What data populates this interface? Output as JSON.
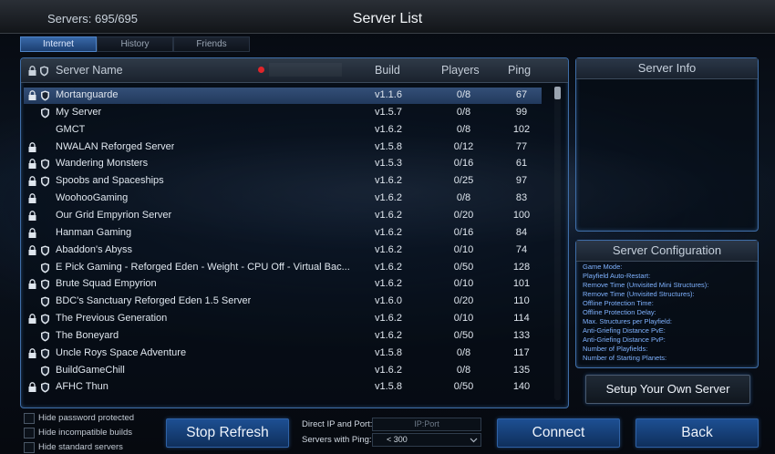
{
  "header": {
    "server_count": "Servers: 695/695",
    "title": "Server List"
  },
  "tabs": [
    {
      "label": "Internet",
      "active": true
    },
    {
      "label": "History"
    },
    {
      "label": "Friends"
    }
  ],
  "columns": {
    "name": "Server Name",
    "build": "Build",
    "players": "Players",
    "ping": "Ping"
  },
  "rows": [
    {
      "name": "Mortanguarde",
      "build": "v1.1.6",
      "players": "0/8",
      "ping": "67",
      "lock": true,
      "shield": true,
      "selected": true
    },
    {
      "name": "My Server",
      "build": "v1.5.7",
      "players": "0/8",
      "ping": "99",
      "lock": false,
      "shield": true
    },
    {
      "name": "GMCT",
      "build": "v1.6.2",
      "players": "0/8",
      "ping": "102",
      "lock": false,
      "shield": false
    },
    {
      "name": "NWALAN Reforged Server",
      "build": "v1.5.8",
      "players": "0/12",
      "ping": "77",
      "lock": true,
      "shield": false
    },
    {
      "name": "Wandering Monsters",
      "build": "v1.5.3",
      "players": "0/16",
      "ping": "61",
      "lock": true,
      "shield": true
    },
    {
      "name": "Spoobs and Spaceships",
      "build": "v1.6.2",
      "players": "0/25",
      "ping": "97",
      "lock": true,
      "shield": true
    },
    {
      "name": "WoohooGaming",
      "build": "v1.6.2",
      "players": "0/8",
      "ping": "83",
      "lock": true,
      "shield": false
    },
    {
      "name": "Our Grid Empyrion Server",
      "build": "v1.6.2",
      "players": "0/20",
      "ping": "100",
      "lock": true,
      "shield": false
    },
    {
      "name": "Hanman Gaming",
      "build": "v1.6.2",
      "players": "0/16",
      "ping": "84",
      "lock": true,
      "shield": false
    },
    {
      "name": "Abaddon's Abyss",
      "build": "v1.6.2",
      "players": "0/10",
      "ping": "74",
      "lock": true,
      "shield": true
    },
    {
      "name": "E Pick Gaming - Reforged Eden - Weight - CPU Off - Virtual Bac...",
      "build": "v1.6.2",
      "players": "0/50",
      "ping": "128",
      "lock": false,
      "shield": true
    },
    {
      "name": "Brute Squad Empyrion",
      "build": "v1.6.2",
      "players": "0/10",
      "ping": "101",
      "lock": true,
      "shield": true
    },
    {
      "name": "BDC's Sanctuary Reforged Eden 1.5 Server",
      "build": "v1.6.0",
      "players": "0/20",
      "ping": "110",
      "lock": false,
      "shield": true
    },
    {
      "name": "The Previous Generation",
      "build": "v1.6.2",
      "players": "0/10",
      "ping": "114",
      "lock": true,
      "shield": true
    },
    {
      "name": "The Boneyard",
      "build": "v1.6.2",
      "players": "0/50",
      "ping": "133",
      "lock": false,
      "shield": true
    },
    {
      "name": "Uncle Roys Space Adventure",
      "build": "v1.5.8",
      "players": "0/8",
      "ping": "117",
      "lock": true,
      "shield": true
    },
    {
      "name": "BuildGameChill",
      "build": "v1.6.2",
      "players": "0/8",
      "ping": "135",
      "lock": false,
      "shield": true
    },
    {
      "name": "AFHC Thun",
      "build": "v1.5.8",
      "players": "0/50",
      "ping": "140",
      "lock": true,
      "shield": true
    }
  ],
  "server_info": {
    "title": "Server Info"
  },
  "server_config": {
    "title": "Server Configuration",
    "items": [
      "Game Mode:",
      "Playfield Auto-Restart:",
      "Remove Time (Unvisited Mini Structures):",
      "Remove Time (Unvisited Structures):",
      "Offline Protection Time:",
      "Offline Protection Delay:",
      "Max. Structures per Playfield:",
      "Anti-Griefing Distance PvE:",
      "Anti-Griefing Distance PvP:",
      "Number of Playfields:",
      "Number of Starting Planets:"
    ]
  },
  "buttons": {
    "setup": "Setup Your Own Server",
    "stop_refresh": "Stop Refresh",
    "connect": "Connect",
    "back": "Back"
  },
  "filters": {
    "hide_password": "Hide password protected",
    "hide_incompatible": "Hide incompatible builds",
    "hide_standard": "Hide standard servers"
  },
  "direct_ip": {
    "label": "Direct IP and Port:",
    "placeholder": "IP:Port"
  },
  "ping_filter": {
    "label": "Servers with Ping:",
    "value": "< 300"
  },
  "colors": {
    "accent": "#3f6ea8",
    "config_text": "#7fb2ff",
    "status_dot": "#e0252a"
  }
}
